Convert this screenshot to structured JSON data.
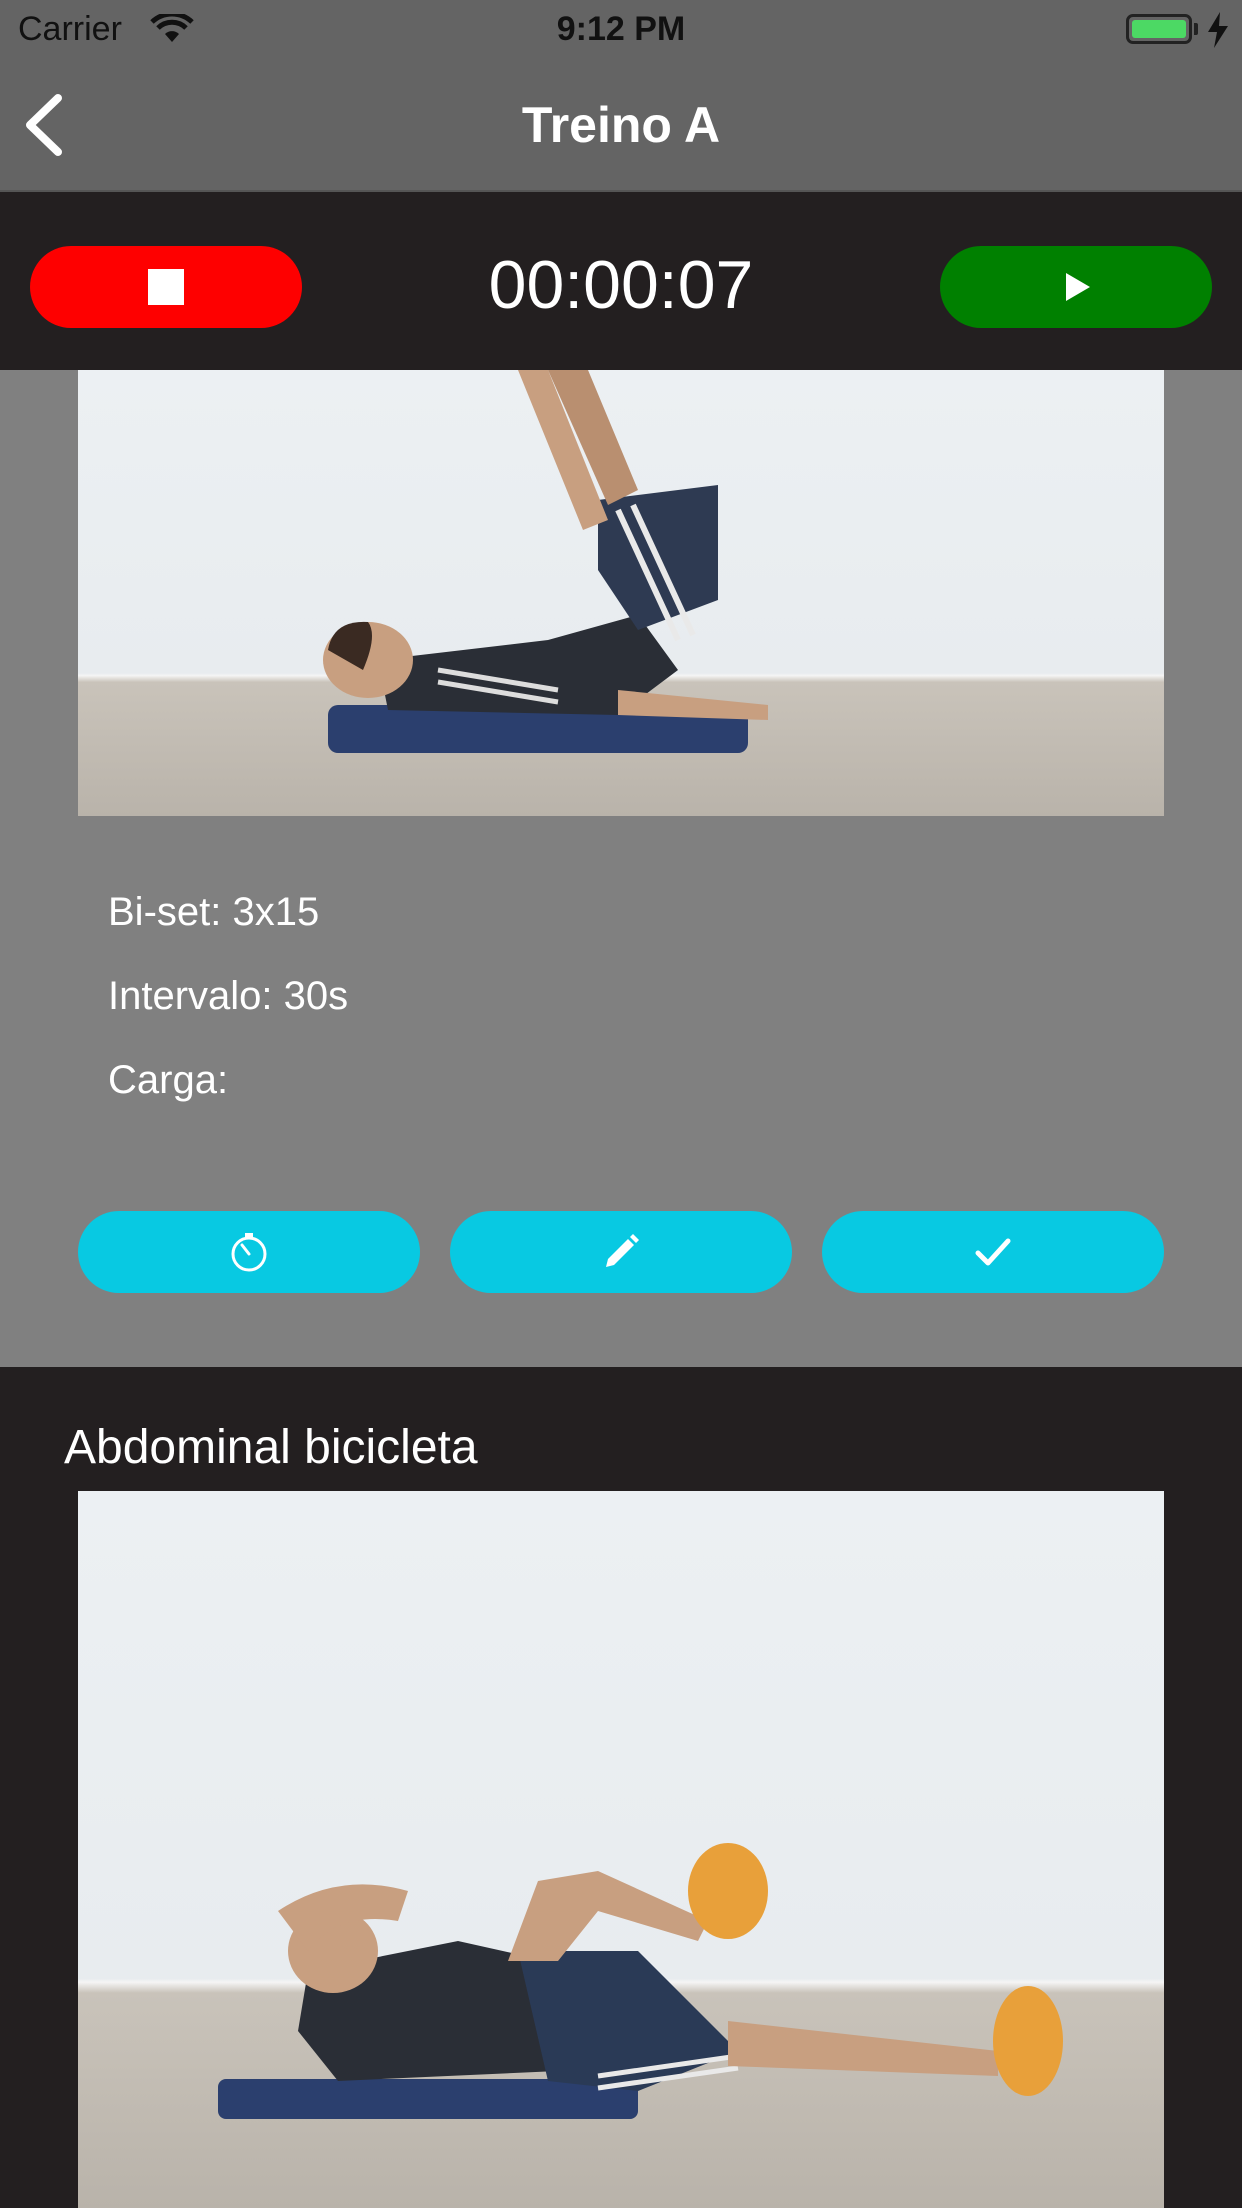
{
  "status_bar": {
    "carrier": "Carrier",
    "time": "9:12 PM"
  },
  "nav": {
    "title": "Treino A"
  },
  "timer": {
    "display": "00:00:07",
    "stop_color": "#fe0000",
    "play_color": "#008000"
  },
  "exercise_1": {
    "sets": "Bi-set: 3x15",
    "interval": "Intervalo: 30s",
    "load": "Carga:",
    "image": "reverse-crunch-photo",
    "actions": [
      "timer-icon",
      "pencil-icon",
      "checkmark-icon"
    ],
    "accent": "#08c9e2"
  },
  "exercise_2": {
    "title": "Abdominal bicicleta",
    "image": "bicycle-crunch-photo"
  }
}
